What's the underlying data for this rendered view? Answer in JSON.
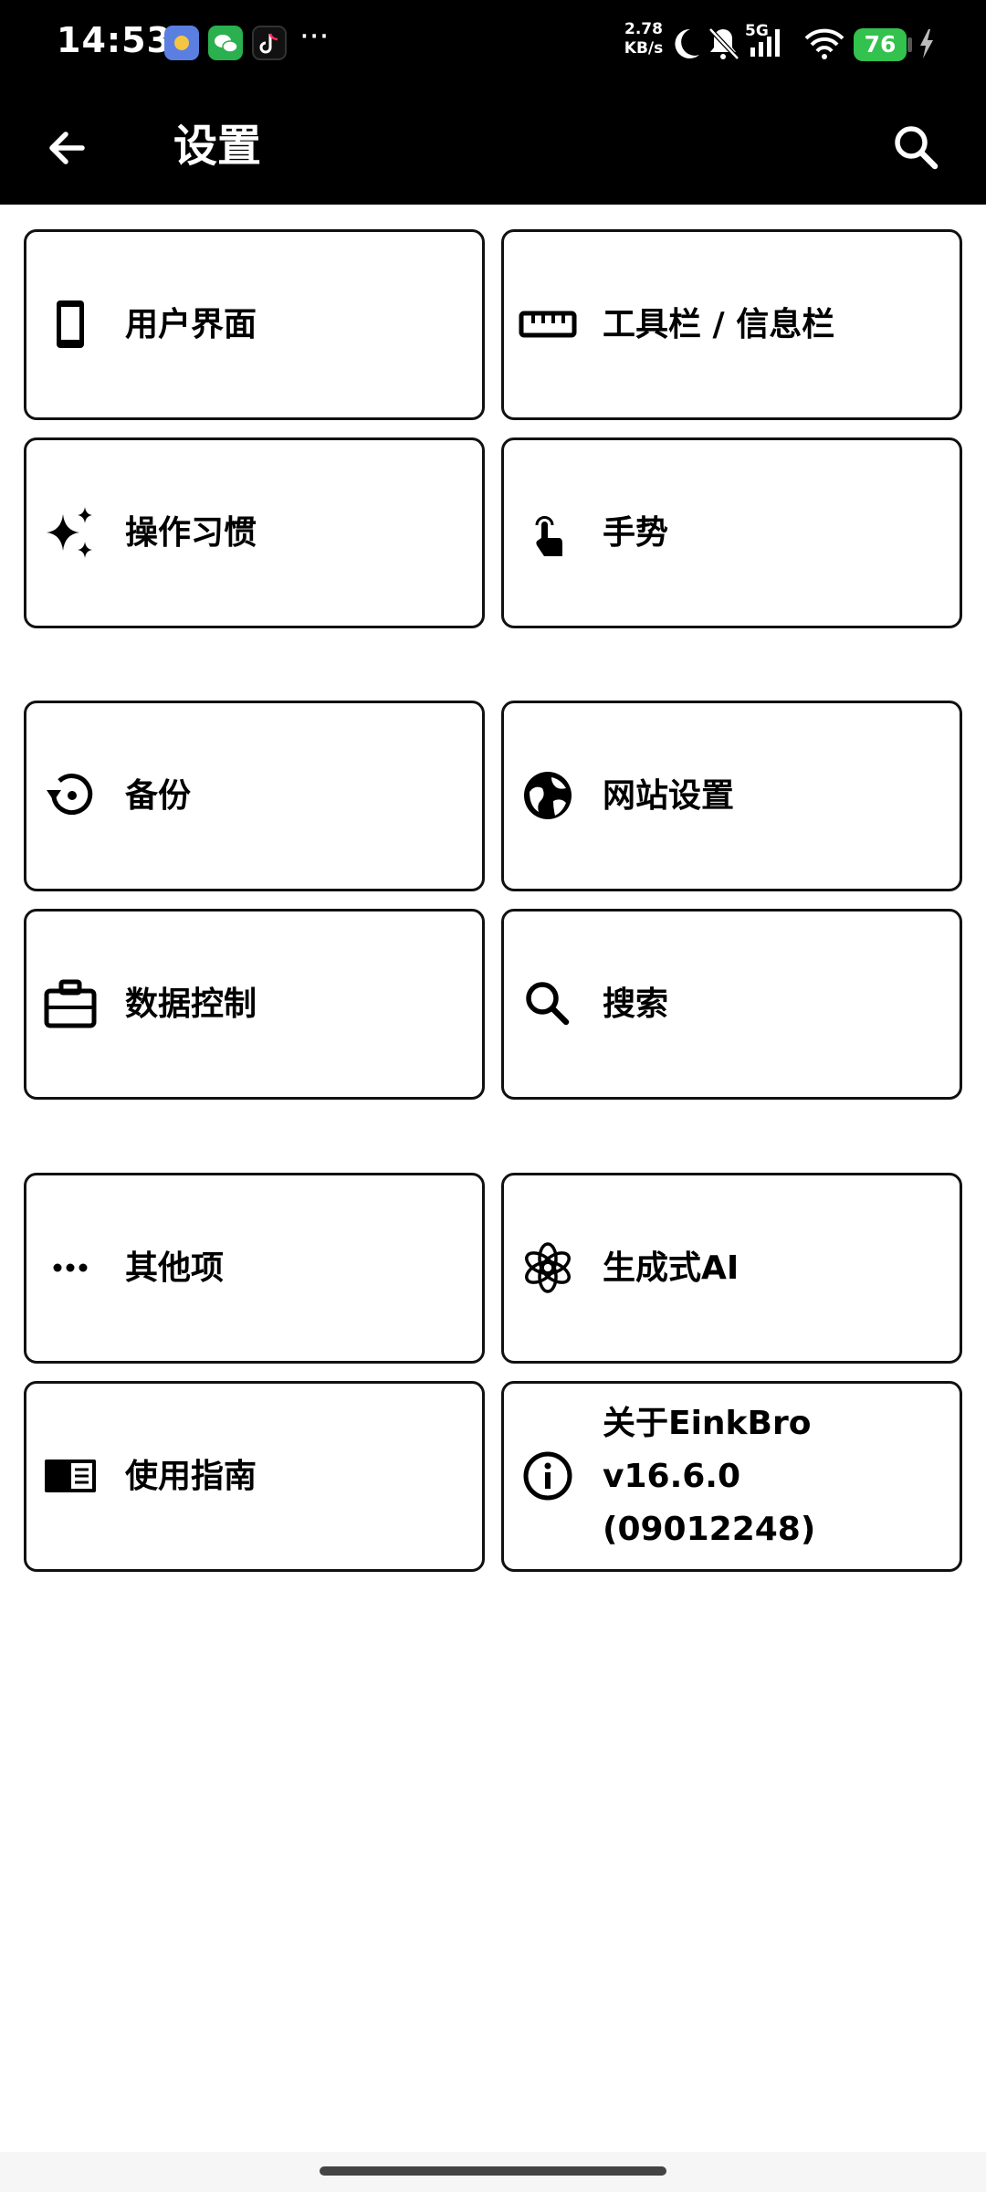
{
  "status_bar": {
    "time": "14:53",
    "more": "···",
    "net_speed_value": "2.78",
    "net_speed_unit": "KB/s",
    "network": "5G",
    "battery": "76",
    "icons": [
      "app-icon-blue",
      "wechat-icon",
      "tiktok-icon",
      "moon-icon",
      "bell-off-icon",
      "signal-icon",
      "wifi-icon",
      "battery-icon",
      "charging-icon"
    ]
  },
  "app_bar": {
    "title": "设置",
    "back_icon": "arrow-left-icon",
    "search_icon": "search-icon"
  },
  "tiles": [
    {
      "label": "用户界面",
      "icon": "phone-icon"
    },
    {
      "label": "工具栏 / 信息栏",
      "icon": "ruler-icon"
    },
    {
      "label": "操作习惯",
      "icon": "sparkle-icon"
    },
    {
      "label": "手势",
      "icon": "touch-icon"
    },
    {
      "label": "备份",
      "icon": "restore-icon"
    },
    {
      "label": "网站设置",
      "icon": "globe-icon"
    },
    {
      "label": "数据控制",
      "icon": "briefcase-icon"
    },
    {
      "label": "搜索",
      "icon": "search-icon"
    },
    {
      "label": "其他项",
      "icon": "more-icon"
    },
    {
      "label": "生成式AI",
      "icon": "ai-knot-icon"
    },
    {
      "label": "使用指南",
      "icon": "guide-icon"
    },
    {
      "label": "关于EinkBro v16.6.0\n(09012248)",
      "icon": "info-icon"
    }
  ],
  "colors": {
    "bar_background": "#000000",
    "page_background": "#ffffff",
    "tile_border": "#111111",
    "battery_green": "#33c24d"
  }
}
